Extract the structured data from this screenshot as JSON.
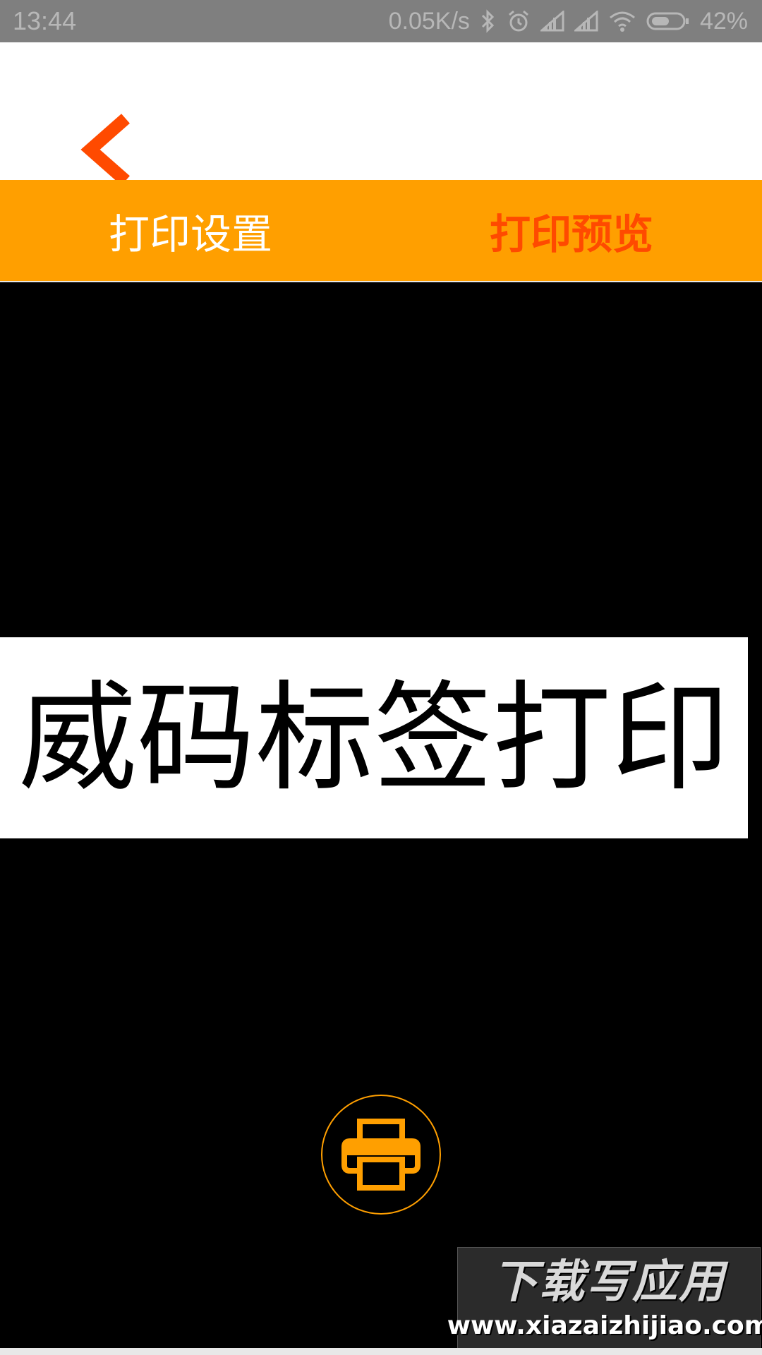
{
  "status_bar": {
    "time": "13:44",
    "network_speed": "0.05K/s",
    "battery": "42%",
    "icons": [
      "bluetooth-icon",
      "alarm-icon",
      "signal-icon",
      "signal-icon",
      "wifi-icon",
      "battery-icon"
    ]
  },
  "nav": {
    "back_icon": "chevron-left-icon"
  },
  "tabs": [
    {
      "label": "打印设置",
      "active": false
    },
    {
      "label": "打印预览",
      "active": true
    }
  ],
  "preview": {
    "label_text": "威码标签打印"
  },
  "actions": {
    "print_icon": "printer-icon"
  },
  "watermark": {
    "title": "下载写应用",
    "url": "www.xiazaizhijiao.com"
  },
  "colors": {
    "accent": "#ff9f00",
    "active_tab": "#ff4a00",
    "status_bar": "#7f7f7f"
  }
}
